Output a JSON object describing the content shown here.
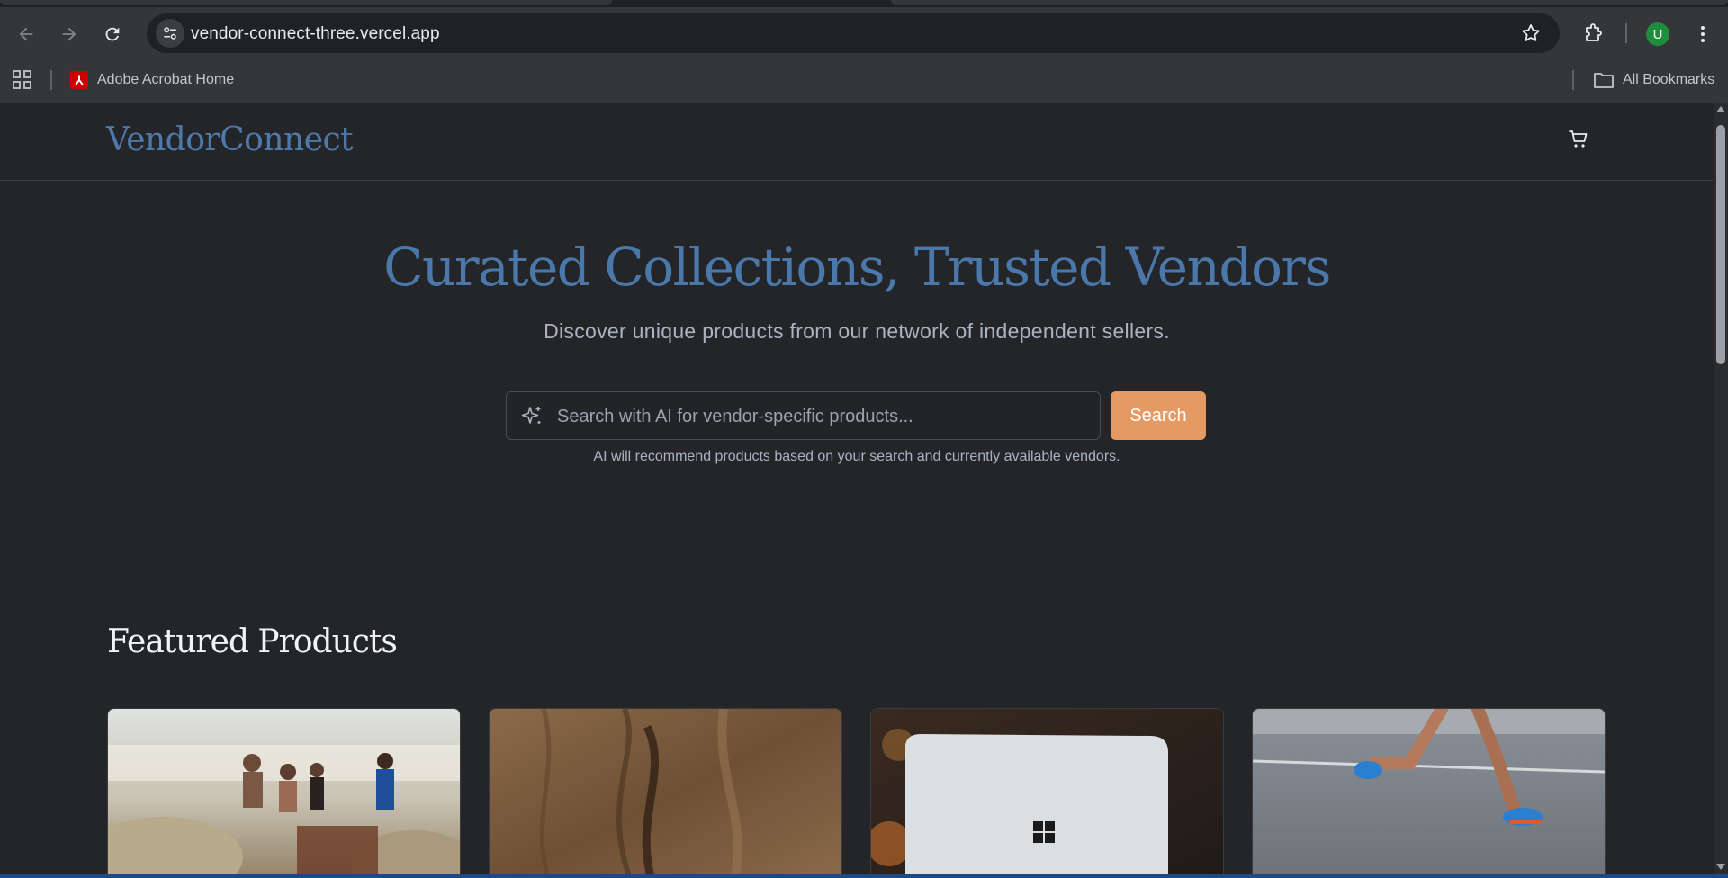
{
  "browser": {
    "url": "vendor-connect-three.vercel.app",
    "profile_initial": "U",
    "bookmarks": [
      {
        "label": "Adobe Acrobat Home",
        "icon": "pdf-icon"
      }
    ],
    "all_bookmarks_label": "All Bookmarks"
  },
  "header": {
    "logo": "VendorConnect",
    "cart_icon": "cart-icon"
  },
  "hero": {
    "title": "Curated Collections, Trusted Vendors",
    "subtitle": "Discover unique products from our network of independent sellers.",
    "search_placeholder": "Search with AI for vendor-specific products...",
    "search_value": "",
    "search_button": "Search",
    "hint": "AI will recommend products based on your search and currently available vendors."
  },
  "featured": {
    "title": "Featured Products",
    "products": [
      {
        "image": "beach-bags-image"
      },
      {
        "image": "wood-grain-image"
      },
      {
        "image": "laptop-image"
      },
      {
        "image": "running-shoes-image"
      }
    ]
  },
  "colors": {
    "accent": "#4a78ab",
    "button": "#e49a62",
    "background": "#242528"
  }
}
